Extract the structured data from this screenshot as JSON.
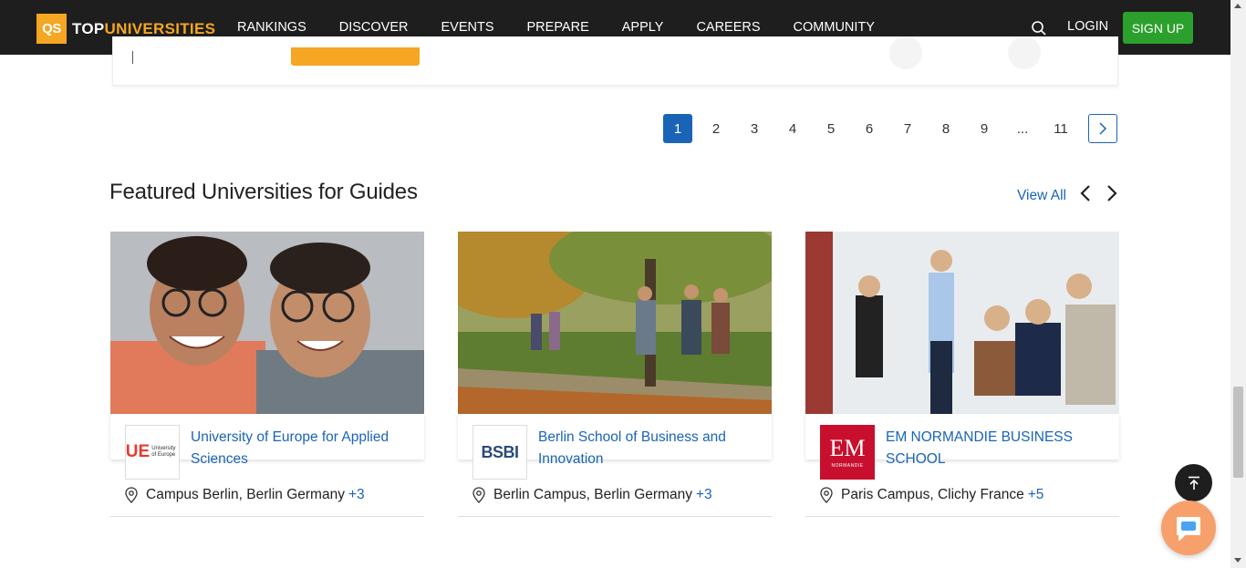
{
  "header": {
    "logo_mark": "QS",
    "logo_top": "TOP",
    "logo_univ": "UNIVERSITIES",
    "nav": [
      "RANKINGS",
      "DISCOVER",
      "EVENTS",
      "PREPARE",
      "APPLY",
      "CAREERS",
      "COMMUNITY"
    ],
    "login": "LOGIN",
    "signup": "SIGN UP"
  },
  "pagination": {
    "pages": [
      "1",
      "2",
      "3",
      "4",
      "5",
      "6",
      "7",
      "8",
      "9",
      "...",
      "11"
    ],
    "current": "1"
  },
  "section": {
    "title": "Featured Universities for Guides",
    "view_all": "View All"
  },
  "cards": [
    {
      "name": "University of Europe for Applied Sciences",
      "location": "Campus Berlin, Berlin Germany",
      "more": "+3",
      "logo_text": "UE",
      "logo_sub": "University of Europe"
    },
    {
      "name": "Berlin School of Business and Innovation",
      "location": "Berlin Campus, Berlin Germany",
      "more": "+3",
      "logo_text": "BSBI"
    },
    {
      "name": "EM NORMANDIE BUSINESS SCHOOL",
      "location": "Paris Campus, Clichy France",
      "more": "+5",
      "logo_text": "EM",
      "logo_sub": "NORMANDIE"
    }
  ],
  "colors": {
    "brand_orange": "#f5a623",
    "link_blue": "#1a64b6",
    "signup_green": "#2ca02c",
    "header_bg": "#1e1e1e",
    "em_red": "#c8102e"
  }
}
